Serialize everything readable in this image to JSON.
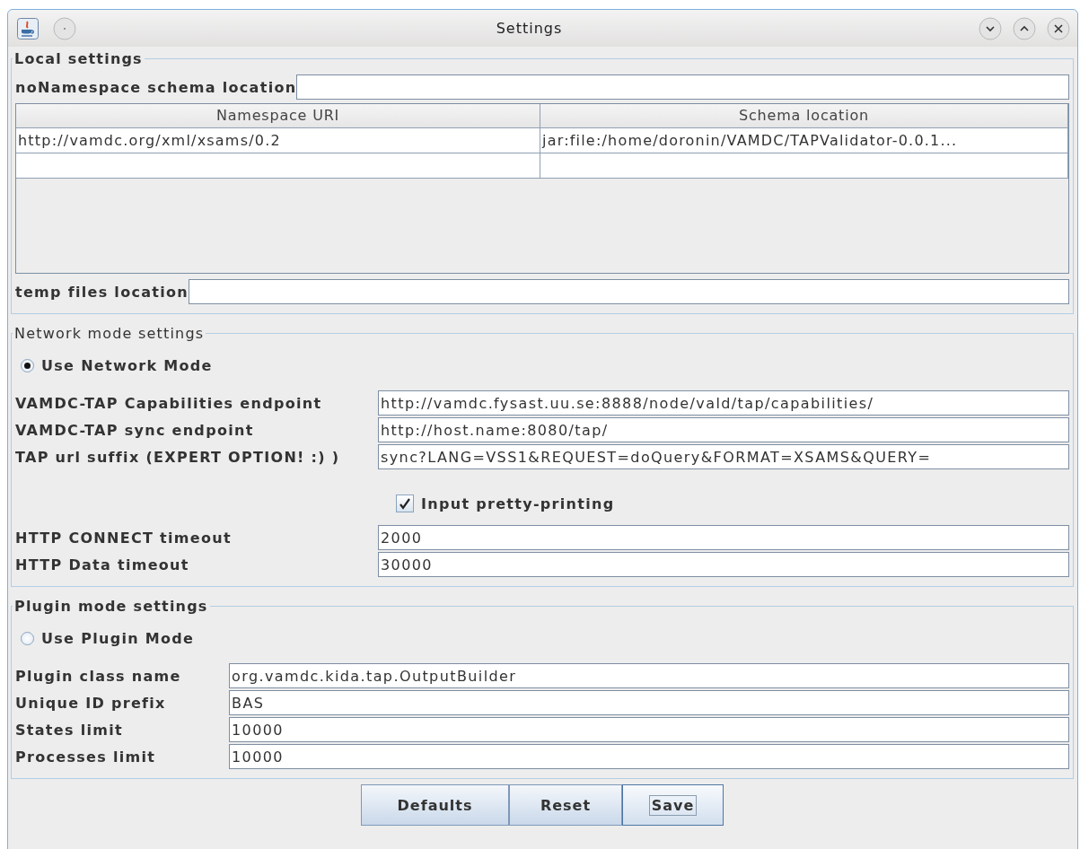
{
  "window": {
    "title": "Settings"
  },
  "local_settings": {
    "legend": "Local settings",
    "no_namespace": {
      "label": "noNamespace schema location"
    },
    "table": {
      "columns": [
        "Namespace URI",
        "Schema location"
      ],
      "rows": [
        {
          "cells": [
            "http://vamdc.org/xml/xsams/0.2",
            "jar:file:/home/doronin/VAMDC/TAPValidator-0.0.1..."
          ]
        }
      ]
    },
    "temp_files": {
      "label": "temp files location"
    }
  },
  "network_settings": {
    "legend": "Network mode settings",
    "mode": {
      "label": "Use Network Mode",
      "selected": true
    },
    "rows": [
      {
        "kind": "field",
        "label": "VAMDC-TAP Capabilities endpoint",
        "value": "http://vamdc.fysast.uu.se:8888/node/vald/tap/capabilities/"
      },
      {
        "kind": "field",
        "label": "VAMDC-TAP sync endpoint",
        "value": "http://host.name:8080/tap/"
      },
      {
        "kind": "field",
        "label": "TAP url suffix (EXPERT OPTION! :) )",
        "value": "sync?LANG=VSS1&REQUEST=doQuery&FORMAT=XSAMS&QUERY="
      },
      {
        "kind": "checkbox",
        "label": "Input pretty-printing",
        "checked": true
      },
      {
        "kind": "field",
        "label": "HTTP CONNECT timeout",
        "value": "2000"
      },
      {
        "kind": "field",
        "label": "HTTP Data timeout",
        "value": "30000"
      }
    ]
  },
  "plugin_settings": {
    "legend": "Plugin mode settings",
    "mode": {
      "label": "Use Plugin Mode",
      "selected": false
    },
    "rows": [
      {
        "kind": "field",
        "label": "Plugin class name",
        "value": "org.vamdc.kida.tap.OutputBuilder"
      },
      {
        "kind": "field",
        "label": "Unique ID prefix",
        "value": "BAS"
      },
      {
        "kind": "field",
        "label": "States limit",
        "value": "10000"
      },
      {
        "kind": "field",
        "label": "Processes limit",
        "value": "10000"
      }
    ]
  },
  "buttons": [
    {
      "label": "Defaults",
      "focused": false
    },
    {
      "label": "Reset",
      "focused": false
    },
    {
      "label": "Save",
      "focused": true
    }
  ]
}
